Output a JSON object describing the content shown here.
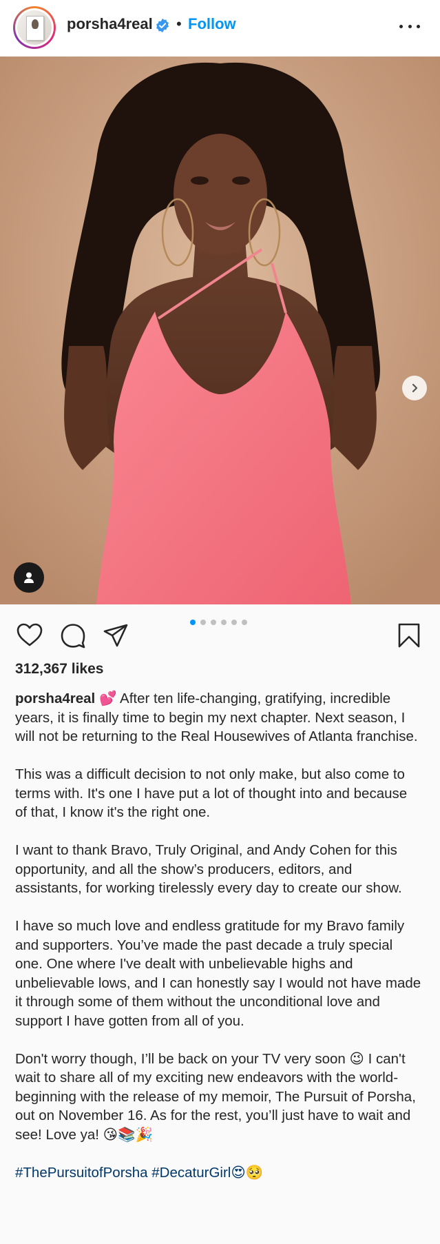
{
  "header": {
    "username": "porsha4real",
    "separator": "•",
    "follow_label": "Follow",
    "verified": true
  },
  "icons": {
    "verified": "verified-badge-icon",
    "more": "more-options-icon",
    "next": "chevron-right-icon",
    "tag": "user-tag-icon",
    "like": "heart-icon",
    "comment": "comment-icon",
    "share": "paper-plane-icon",
    "save": "bookmark-icon"
  },
  "colors": {
    "accent": "#0095f6",
    "text": "#262626",
    "hashtag": "#00376b",
    "dress": "#f4727e"
  },
  "carousel": {
    "total": 6,
    "active": 1
  },
  "post": {
    "likes": "312,367 likes",
    "caption_user": "porsha4real",
    "para1": "💕 After ten life-changing, gratifying, incredible years, it is finally time to begin my next chapter. Next season, I will not be returning to the Real Housewives of Atlanta franchise.",
    "para2": "This was a difficult decision to not only make, but also come to terms with. It's one I have put a lot of thought into and because of that, I know it's the right one.",
    "para3": "I want to thank Bravo, Truly Original, and Andy Cohen for this opportunity, and all the show’s producers, editors, and assistants, for working tirelessly every day to create our show.",
    "para4": "I have so much love and endless gratitude for my Bravo family and supporters. You’ve made the past decade a truly special one. One where I've dealt with unbelievable highs and unbelievable lows, and I can honestly say I would not have made it through some of them without the unconditional love and support I have gotten from all of you.",
    "para5": "Don't worry though, I’ll be back on your TV very soon 😉 I can't wait to share all of my exciting new endeavors with the world-beginning with the release of my memoir, The Pursuit of Porsha, out on November 16. As for the rest, you’ll just have to wait and see! Love ya! 😘📚🎉",
    "hashtag1": "#ThePursuitofPorsha",
    "hashtag2": "#DecaturGirl",
    "hashtag_emoji": "😍🥺"
  }
}
